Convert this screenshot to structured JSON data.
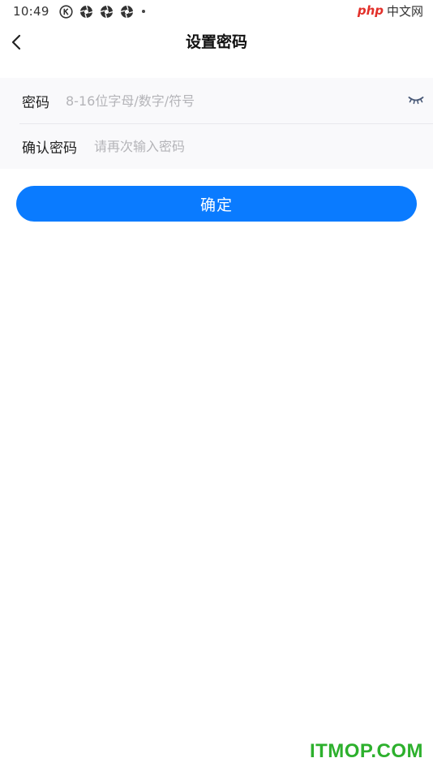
{
  "status_bar": {
    "time": "10:49",
    "icons": [
      "k-circle-icon",
      "aperture-icon",
      "aperture-icon",
      "aperture-icon"
    ],
    "watermark_php": "php",
    "watermark_cn": "中文网"
  },
  "header": {
    "title": "设置密码",
    "back_icon": "chevron-left-icon"
  },
  "form": {
    "password": {
      "label": "密码",
      "placeholder": "8-16位字母/数字/符号",
      "value": "",
      "toggle_icon": "eye-closed-icon"
    },
    "confirm_password": {
      "label": "确认密码",
      "placeholder": "请再次输入密码",
      "value": ""
    }
  },
  "confirm_button": {
    "label": "确定"
  },
  "watermark": {
    "text": "ITMOP.COM"
  },
  "colors": {
    "primary": "#0a7bff",
    "form_background": "#f9f9fb",
    "placeholder": "#b4b4b8",
    "watermark_green": "#2db02d",
    "watermark_red": "#e2302a"
  }
}
